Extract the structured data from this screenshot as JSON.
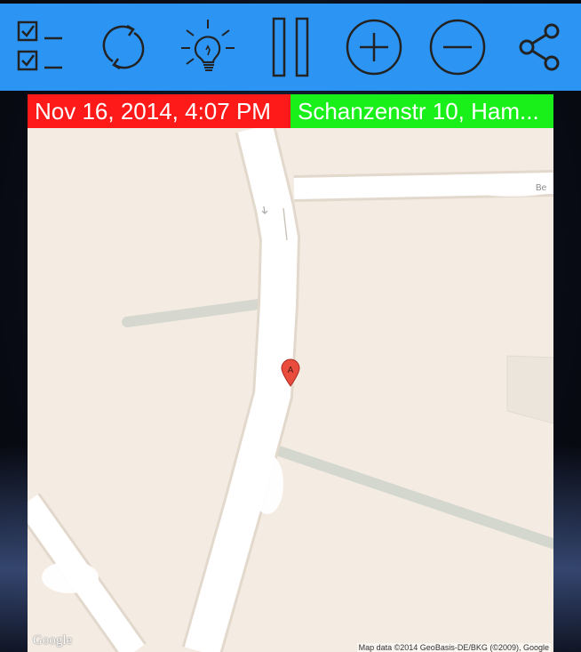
{
  "toolbar": {
    "background": "#2c95f4",
    "buttons": [
      {
        "icon": "checklist-icon"
      },
      {
        "icon": "refresh-icon"
      },
      {
        "icon": "lightbulb-icon"
      },
      {
        "icon": "pause-icon"
      },
      {
        "icon": "zoom-in-icon"
      },
      {
        "icon": "zoom-out-icon"
      },
      {
        "icon": "share-icon"
      }
    ]
  },
  "status": {
    "left_text": "Nov 16, 2014, 4:07 PM",
    "left_color": "#ff1a1a",
    "right_text": "Schanzenstr 10, Ham...",
    "right_color": "#19f019"
  },
  "map": {
    "marker_label": "A",
    "street_label": "Be",
    "google_logo": "Google",
    "attribution": "Map data ©2014 GeoBasis-DE/BKG (©2009), Google"
  }
}
